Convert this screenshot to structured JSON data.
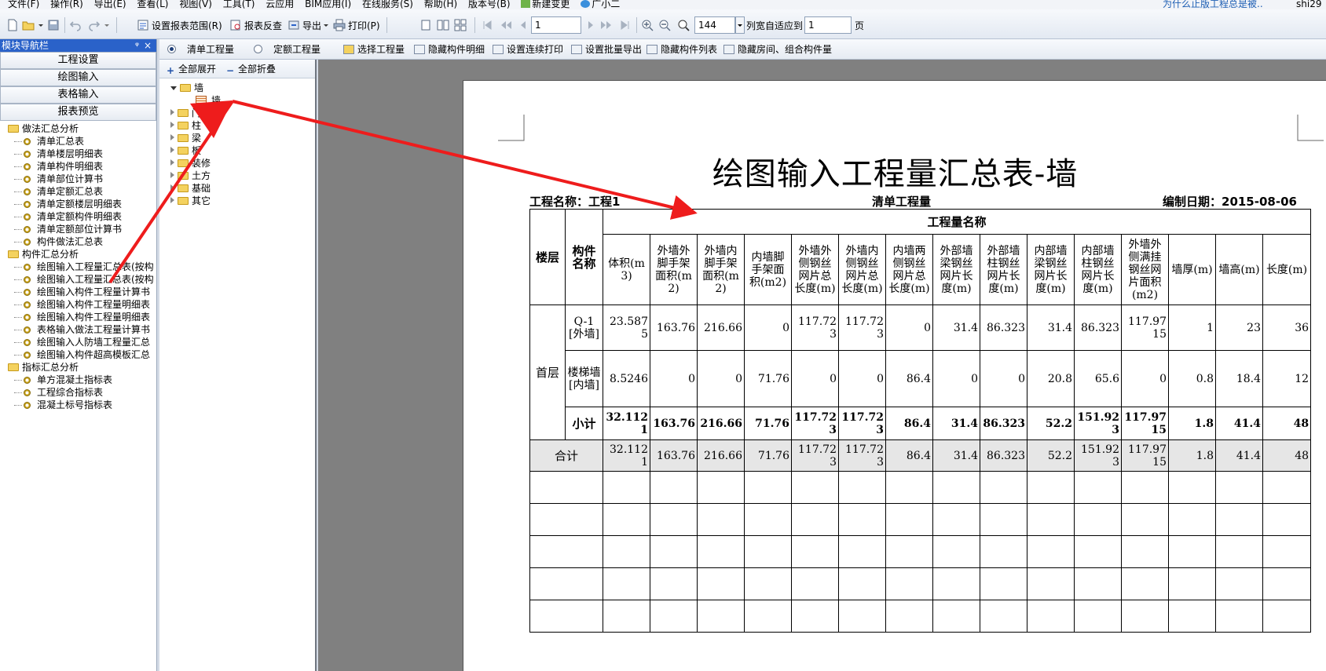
{
  "menubar": {
    "items": [
      "文件(F)",
      "操作(R)",
      "导出(E)",
      "查看(L)",
      "视图(V)",
      "工具(T)",
      "云应用",
      "BIM应用(I)",
      "在线服务(S)",
      "帮助(H)",
      "版本号(B)",
      "新建变更",
      "广小二"
    ],
    "hint": "为什么止版工程总是被..",
    "user": "shi29"
  },
  "toolbar": {
    "set_range": "设置报表范围(R)",
    "report_check": "报表反查",
    "export": "导出",
    "print": "打印(P)",
    "page_value": "1",
    "zoom_value": "144",
    "fit_cols_label": "列宽自适应到",
    "fit_cols_value": "1",
    "page_unit": "页"
  },
  "left": {
    "title": "模块导航栏",
    "pin": "ᵠ",
    "close": "×",
    "nav_buttons": [
      "工程设置",
      "绘图输入",
      "表格输入",
      "报表预览"
    ],
    "groups": [
      {
        "label": "做法汇总分析",
        "items": [
          "清单汇总表",
          "清单楼层明细表",
          "清单构件明细表",
          "清单部位计算书",
          "清单定额汇总表",
          "清单定额楼层明细表",
          "清单定额构件明细表",
          "清单定额部位计算书",
          "构件做法汇总表"
        ]
      },
      {
        "label": "构件汇总分析",
        "items": [
          "绘图输入工程量汇总表(按构",
          "绘图输入工程量汇总表(按构",
          "绘图输入构件工程量计算书",
          "绘图输入构件工程量明细表",
          "绘图输入构件工程量明细表",
          "表格输入做法工程量计算书",
          "绘图输入人防墙工程量汇总",
          "绘图输入构件超高模板汇总"
        ]
      },
      {
        "label": "指标汇总分析",
        "items": [
          "单方混凝土指标表",
          "工程综合指标表",
          "混凝土标号指标表"
        ]
      }
    ]
  },
  "rtoolbar": {
    "radio_bill": "清单工程量",
    "radio_quota": "定额工程量",
    "select_qty": "选择工程量",
    "hide_detail": "隐藏构件明细",
    "set_cont_print": "设置连续打印",
    "set_batch_export": "设置批量导出",
    "hide_comp_list": "隐藏构件列表",
    "hide_rooms": "隐藏房间、组合构件量"
  },
  "mid": {
    "expand_all": "全部展开",
    "collapse_all": "全部折叠",
    "root": "墙",
    "child": "墙",
    "others": [
      "门窗洞",
      "柱",
      "梁",
      "板",
      "装修",
      "土方",
      "基础",
      "其它"
    ]
  },
  "report": {
    "title": "绘图输入工程量汇总表-墙",
    "project_label": "工程名称：工程1",
    "qty_type": "清单工程量",
    "date_label": "编制日期：2015-08-06",
    "headers": {
      "floor": "楼层",
      "component": "构件名称",
      "group": "工程量名称",
      "cols": [
        "体积(m3)",
        "外墙外脚手架面积(m2)",
        "外墙内脚手架面积(m2)",
        "内墙脚手架面积(m2)",
        "外墙外侧钢丝网片总长度(m)",
        "外墙内侧钢丝网片总长度(m)",
        "内墙两侧钢丝网片总长度(m)",
        "外部墙梁钢丝网片长度(m)",
        "外部墙柱钢丝网片长度(m)",
        "内部墙梁钢丝网片长度(m)",
        "内部墙柱钢丝网片长度(m)",
        "外墙外侧满挂钢丝网片面积(m2)",
        "墙厚(m)",
        "墙高(m)",
        "长度(m)"
      ]
    },
    "floor_name": "首层",
    "rows": [
      {
        "name": "Q-1[外墙]",
        "values": [
          "23.5875",
          "163.76",
          "216.66",
          "0",
          "117.723",
          "117.723",
          "0",
          "31.4",
          "86.323",
          "31.4",
          "86.323",
          "117.9715",
          "1",
          "23",
          "36"
        ]
      },
      {
        "name": "楼梯墙[内墙]",
        "values": [
          "8.5246",
          "0",
          "0",
          "71.76",
          "0",
          "0",
          "86.4",
          "0",
          "0",
          "20.8",
          "65.6",
          "0",
          "0.8",
          "18.4",
          "12"
        ]
      }
    ],
    "subtotal": {
      "name": "小计",
      "values": [
        "32.1121",
        "163.76",
        "216.66",
        "71.76",
        "117.723",
        "117.723",
        "86.4",
        "31.4",
        "86.323",
        "52.2",
        "151.923",
        "117.9715",
        "1.8",
        "41.4",
        "48"
      ]
    },
    "total": {
      "name": "合计",
      "values": [
        "32.1121",
        "163.76",
        "216.66",
        "71.76",
        "117.723",
        "117.723",
        "86.4",
        "31.4",
        "86.323",
        "52.2",
        "151.923",
        "117.9715",
        "1.8",
        "41.4",
        "48"
      ]
    }
  },
  "colors": {
    "title_bar": "#2a62c9",
    "arrow": "#ee1c1c",
    "viewer_bg": "#808080",
    "total_row": "#e6e6e6"
  }
}
